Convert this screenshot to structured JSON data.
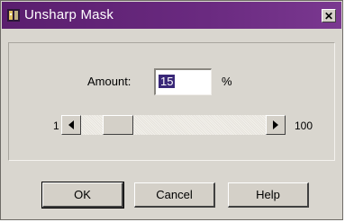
{
  "window": {
    "title": "Unsharp Mask",
    "titlebar_color": "#5a1e6e",
    "app_icon": "app-icon",
    "close_icon": "close-icon",
    "close_glyph": "✕"
  },
  "amount": {
    "label": "Amount:",
    "value": "15",
    "unit": "%"
  },
  "slider": {
    "min_label": "1",
    "max_label": "100",
    "min": 1,
    "max": 100,
    "value": 15,
    "left_icon": "arrow-left-icon",
    "right_icon": "arrow-right-icon"
  },
  "buttons": {
    "ok": "OK",
    "cancel": "Cancel",
    "help": "Help"
  }
}
